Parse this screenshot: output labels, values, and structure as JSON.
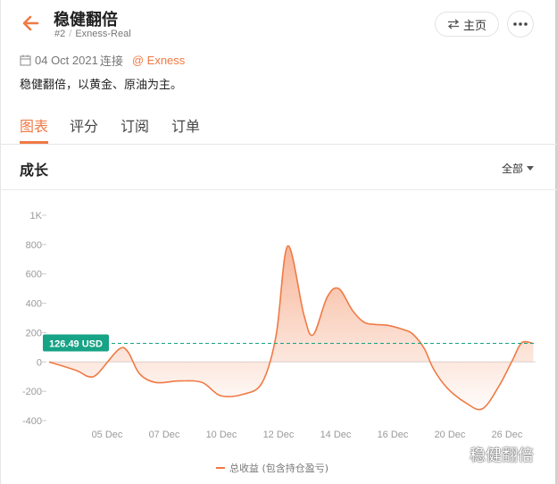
{
  "header": {
    "title": "稳健翻倍",
    "account_id": "#2",
    "account_server": "Exness-Real",
    "home_label": "主页"
  },
  "meta": {
    "date": "04 Oct 2021",
    "connect_label": "连接",
    "broker": "@ Exness"
  },
  "description": "稳健翻倍，以黄金、原油为主。",
  "tabs": [
    {
      "label": "图表",
      "active": true
    },
    {
      "label": "评分",
      "active": false
    },
    {
      "label": "订阅",
      "active": false
    },
    {
      "label": "订单",
      "active": false
    }
  ],
  "section": {
    "title": "成长",
    "range": "全部"
  },
  "colors": {
    "accent": "#f07a45",
    "current_value_badge": "#17a385",
    "grid": "#e8e8e8"
  },
  "chart_data": {
    "type": "area",
    "y_tick_labels": [
      "1K",
      "800",
      "600",
      "400",
      "200",
      "0",
      "-200",
      "-400"
    ],
    "y_ticks": [
      1000,
      800,
      600,
      400,
      200,
      0,
      -200,
      -400
    ],
    "ylim": [
      -400,
      1000
    ],
    "x_tick_labels": [
      "05 Dec",
      "07 Dec",
      "10 Dec",
      "12 Dec",
      "14 Dec",
      "16 Dec",
      "20 Dec",
      "26 Dec"
    ],
    "x_range": [
      0,
      10.5
    ],
    "current_value": 126.49,
    "current_value_label": "126.49 USD",
    "series": [
      {
        "name": "总收益 (包含持仓盈亏)",
        "x": [
          0,
          0.6,
          0.85,
          1.05,
          1.5,
          1.7,
          1.95,
          2.3,
          2.8,
          3.3,
          3.7,
          4.2,
          4.6,
          4.9,
          5.15,
          5.5,
          5.7,
          6.0,
          6.25,
          6.55,
          6.8,
          7.05,
          7.3,
          7.65,
          7.85,
          8.1,
          8.3,
          8.6,
          9.0,
          9.35,
          9.7,
          10.0,
          10.2,
          10.45
        ],
        "y": [
          0,
          -60,
          -100,
          -80,
          85,
          70,
          -80,
          -140,
          -130,
          -140,
          -230,
          -220,
          -140,
          180,
          790,
          320,
          185,
          440,
          500,
          350,
          270,
          255,
          250,
          220,
          190,
          90,
          -50,
          -180,
          -280,
          -320,
          -170,
          10,
          130,
          126.49
        ]
      }
    ]
  },
  "watermark": "稳健翻倍"
}
